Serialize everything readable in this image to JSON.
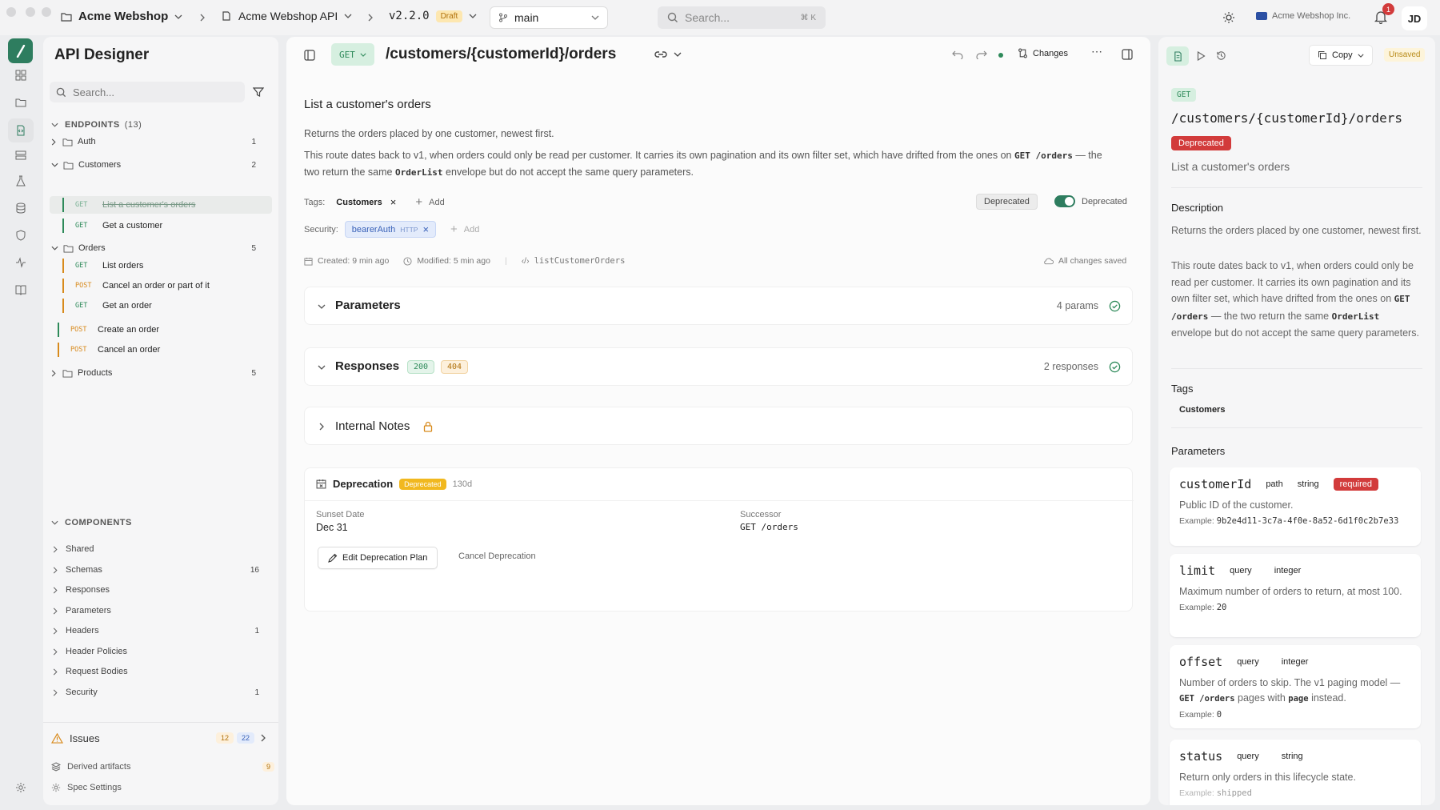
{
  "topbar": {
    "workspace": "Acme Webshop",
    "api": "Acme Webshop API",
    "version": "v2.2.0",
    "version_badge": "Draft",
    "branch": "main",
    "search_placeholder": "Search...",
    "search_shortcut": "⌘ K",
    "org": "Acme Webshop Inc.",
    "notif_count": "1",
    "avatar": "JD"
  },
  "sidebar": {
    "title": "API Designer",
    "search_placeholder": "Search...",
    "endpoints_label": "ENDPOINTS",
    "endpoints_count": "(13)",
    "groups": [
      {
        "name": "Auth",
        "count": "1"
      },
      {
        "name": "Customers",
        "count": "2"
      },
      {
        "name": "Orders",
        "count": "5"
      },
      {
        "name": "Products",
        "count": "5"
      }
    ],
    "customers_endpoints": [
      {
        "method": "GET",
        "label": "List a customer's orders"
      },
      {
        "method": "GET",
        "label": "Get a customer"
      }
    ],
    "orders_endpoints": [
      {
        "method": "GET",
        "label": "List orders"
      },
      {
        "method": "POST",
        "label": "Cancel an order or part of it"
      },
      {
        "method": "GET",
        "label": "Get an order"
      }
    ],
    "loose_endpoints": [
      {
        "method": "POST",
        "label": "Create an order"
      },
      {
        "method": "POST",
        "label": "Cancel an order"
      }
    ],
    "components_label": "COMPONENTS",
    "components": [
      {
        "name": "Shared",
        "count": ""
      },
      {
        "name": "Schemas",
        "count": "16"
      },
      {
        "name": "Responses",
        "count": ""
      },
      {
        "name": "Parameters",
        "count": ""
      },
      {
        "name": "Headers",
        "count": "1"
      },
      {
        "name": "Header Policies",
        "count": ""
      },
      {
        "name": "Request Bodies",
        "count": ""
      },
      {
        "name": "Security",
        "count": "1"
      }
    ],
    "issues_label": "Issues",
    "issues_warn": "12",
    "issues_info": "22",
    "derived_label": "Derived artifacts",
    "derived_count": "9",
    "settings_label": "Spec Settings"
  },
  "main": {
    "method": "GET",
    "path": "/customers/{customerId}/orders",
    "changes_label": "Changes",
    "summary": "List a customer's orders",
    "desc1": "Returns the orders placed by one customer, newest first.",
    "desc2a": "This route dates back to v1, when orders could only be read per customer. It carries its own pagination and its own filter set, which have drifted from the ones on",
    "desc2_code1": "GET /orders",
    "desc2b": "— the two return the same",
    "desc2_code2": "OrderList",
    "desc2c": "envelope but do not accept the same query parameters.",
    "tags_label": "Tags:",
    "tag": "Customers",
    "add_label": "Add",
    "deprecated_badge": "Deprecated",
    "deprecated_toggle_label": "Deprecated",
    "security_label": "Security:",
    "security_scheme": "bearerAuth",
    "security_type": "HTTP",
    "created": "Created: 9 min ago",
    "modified": "Modified: 5 min ago",
    "operation_id": "listCustomerOrders",
    "saved": "All changes saved",
    "parameters_title": "Parameters",
    "parameters_count": "4 params",
    "responses_title": "Responses",
    "resp_200": "200",
    "resp_404": "404",
    "responses_count": "2 responses",
    "notes_title": "Internal Notes",
    "deprecation_title": "Deprecation",
    "deprecation_badge": "Deprecated",
    "deprecation_days": "130d",
    "sunset_label": "Sunset Date",
    "sunset_value": "Dec 31",
    "successor_label": "Successor",
    "successor_value": "GET /orders",
    "edit_plan": "Edit Deprecation Plan",
    "cancel_deprecation": "Cancel Deprecation"
  },
  "right": {
    "copy_label": "Copy",
    "unsaved": "Unsaved",
    "method": "GET",
    "path": "/customers/{customerId}/orders",
    "deprecated": "Deprecated",
    "summary": "List a customer's orders",
    "description_title": "Description",
    "desc1": "Returns the orders placed by one customer, newest first.",
    "desc2a": "This route dates back to v1, when orders could only be read per customer. It carries its own pagination and its own filter set, which have drifted from the ones on",
    "desc2_code1": "GET /orders",
    "desc2b": "— the two return the same",
    "desc2_code2": "OrderList",
    "desc2c": "envelope but do not accept the same query parameters.",
    "tags_title": "Tags",
    "tag": "Customers",
    "params_title": "Parameters",
    "params": [
      {
        "name": "customerId",
        "in": "path",
        "type": "string",
        "required": "required",
        "desc": "Public ID of the customer.",
        "example_label": "Example:",
        "example": "9b2e4d11-3c7a-4f0e-8a52-6d1f0c2b7e33"
      },
      {
        "name": "limit",
        "in": "query",
        "type": "integer",
        "desc": "Maximum number of orders to return, at most 100.",
        "example_label": "Example:",
        "example": "20"
      },
      {
        "name": "offset",
        "in": "query",
        "type": "integer",
        "desc_a": "Number of orders to skip. The v1 paging model —",
        "desc_code1": "GET /orders",
        "desc_b": "pages with",
        "desc_code2": "page",
        "desc_c": "instead.",
        "example_label": "Example:",
        "example": "0"
      },
      {
        "name": "status",
        "in": "query",
        "type": "string",
        "desc": "Return only orders in this lifecycle state.",
        "example_label": "Example:",
        "example": "shipped"
      }
    ]
  },
  "colors": {
    "accent": "#2e8a5a",
    "warning": "#d88a1c",
    "danger": "#d23b3b",
    "badge_yellow": "#f1b81f"
  }
}
